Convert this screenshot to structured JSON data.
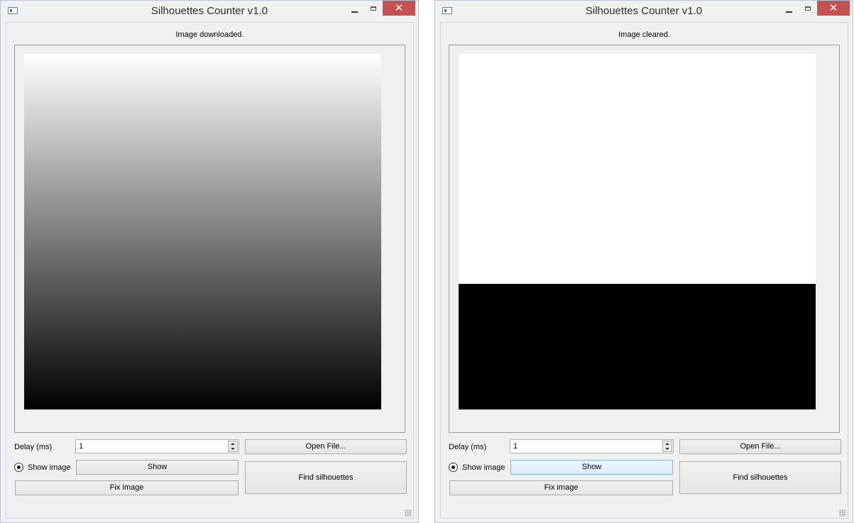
{
  "windows": [
    {
      "title": "Silhouettes Counter v1.0",
      "status": "Image downloaded.",
      "canvas_content": "vertical white-to-black gradient",
      "delay_label": "Delay (ms)",
      "delay_value": "1",
      "show_image_label": "Show image",
      "show_image_checked": true,
      "show_button": "Show",
      "fix_image_button": "Fix image",
      "open_file_button": "Open File...",
      "find_silhouettes_button": "Find silhouettes",
      "close_glyph": "✕"
    },
    {
      "title": "Silhouettes Counter v1.0",
      "status": "Image cleared.",
      "canvas_content": "white top, black bottom",
      "delay_label": "Delay (ms)",
      "delay_value": "1",
      "show_image_label": "Show image",
      "show_image_checked": true,
      "show_button": "Show",
      "fix_image_button": "Fix image",
      "open_file_button": "Open File...",
      "find_silhouettes_button": "Find silhouettes",
      "close_glyph": "✕"
    }
  ],
  "colors": {
    "close_button": "#c75050",
    "window_bg": "#f0f0f0",
    "hover_button": "#dcecfc"
  }
}
